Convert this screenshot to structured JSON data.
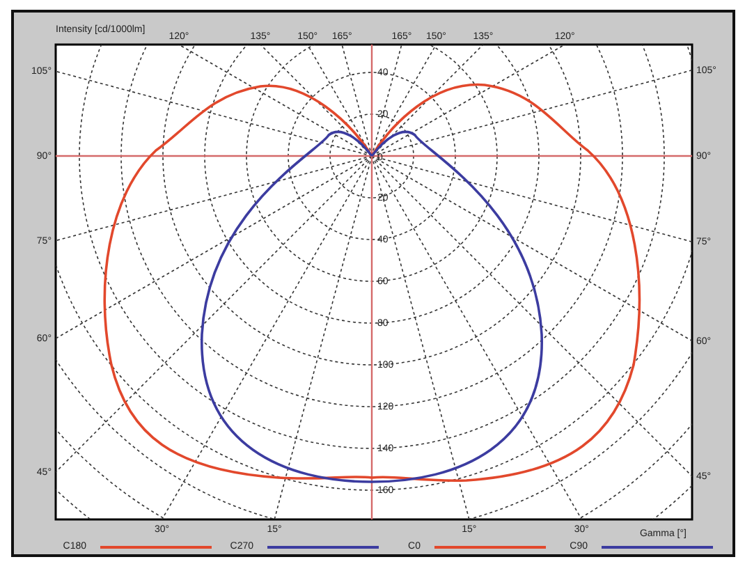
{
  "chart": {
    "ylabel": "Intensity [cd/1000lm]",
    "xlabel": "Gamma [°]",
    "top_angle_labels": [
      "120°",
      "135°",
      "150°",
      "165°",
      "165°",
      "150°",
      "135°",
      "120°"
    ],
    "left_angle_labels": [
      "105°",
      "90°",
      "75°",
      "60°",
      "45°"
    ],
    "right_angle_labels": [
      "105°",
      "90°",
      "75°",
      "60°",
      "45°"
    ],
    "bottom_angle_labels": [
      "30°",
      "15°",
      "15°",
      "30°"
    ],
    "intensity_labels_up": [
      "40",
      "20"
    ],
    "center_label": "0",
    "intensity_labels_down": [
      "20",
      "40",
      "60",
      "80",
      "100",
      "120",
      "140",
      "160"
    ]
  },
  "legend": [
    {
      "label": "C180",
      "color": "#e2482c"
    },
    {
      "label": "C270",
      "color": "#3c3ca0"
    },
    {
      "label": "C0",
      "color": "#e2482c"
    },
    {
      "label": "C90",
      "color": "#3c3ca0"
    }
  ]
}
